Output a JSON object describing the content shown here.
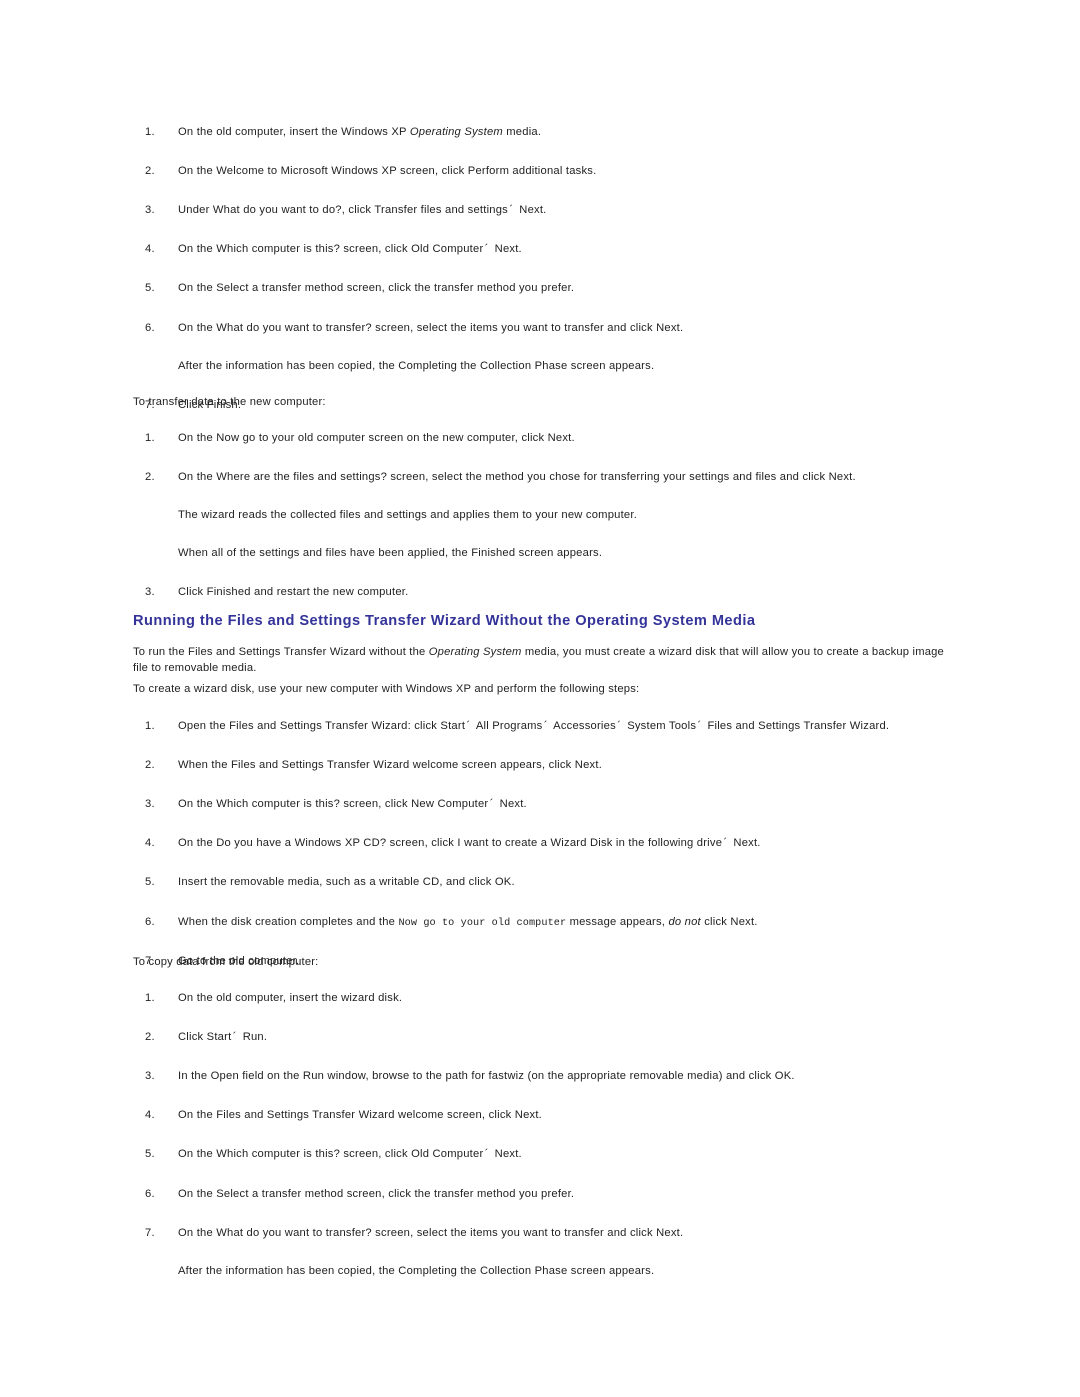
{
  "document": {
    "title": "Files and Settings Transfer Wizard",
    "heading_color": "#333399",
    "body_color": "#1f1f1f",
    "background": "#ffffff",
    "arrow_glyph": "´"
  },
  "section_one": {
    "steps_old_computer": [
      {
        "number": "1.",
        "parts": [
          {
            "text": "On the old computer, insert the Windows XP "
          },
          {
            "text": "Operating System",
            "style": "italic"
          },
          {
            "text": " media."
          }
        ]
      },
      {
        "number": "2.",
        "parts": [
          {
            "text": "On the Welcome to Microsoft Windows XP screen, click Perform additional tasks."
          }
        ]
      },
      {
        "number": "3.",
        "parts": [
          {
            "text": "Under What do you want to do?, click Transfer files and settings"
          },
          {
            "text": "´",
            "style": "arrow"
          },
          {
            "text": " Next."
          }
        ]
      },
      {
        "number": "4.",
        "parts": [
          {
            "text": "On the Which computer is this? screen, click Old Computer"
          },
          {
            "text": "´",
            "style": "arrow"
          },
          {
            "text": " Next."
          }
        ]
      },
      {
        "number": "5.",
        "parts": [
          {
            "text": "On the Select a transfer method screen, click the transfer method you prefer."
          }
        ]
      },
      {
        "number": "6.",
        "parts": [
          {
            "text": "On the What do you want to transfer? screen, select the items you want to transfer and click Next."
          }
        ],
        "note": "After the information has been copied, the Completing the Collection Phase screen appears."
      },
      {
        "number": "7.",
        "parts": [
          {
            "text": "Click Finish."
          }
        ]
      }
    ],
    "transfer_lead_in": "To transfer data to the new computer:",
    "steps_new_computer": [
      {
        "number": "1.",
        "parts": [
          {
            "text": "On the Now go to your old computer screen on the new computer, click Next."
          }
        ]
      },
      {
        "number": "2.",
        "parts": [
          {
            "text": "On the Where are the files and settings? screen, select the method you chose for transferring your settings and files and click Next."
          }
        ],
        "note": "The wizard reads the collected files and settings and applies them to your new computer.",
        "note2": "When all of the settings and files have been applied, the Finished screen appears."
      },
      {
        "number": "3.",
        "parts": [
          {
            "text": "Click Finished and restart the new computer."
          }
        ]
      }
    ]
  },
  "section_two": {
    "heading": "Running the Files and Settings Transfer Wizard Without the Operating System Media",
    "intro_parts": [
      {
        "text": "To run the Files and Settings Transfer Wizard without the "
      },
      {
        "text": "Operating System",
        "style": "italic"
      },
      {
        "text": " media, you must create a wizard disk that will allow you to create a backup image file to removable media."
      }
    ],
    "sub_lead_in": "To create a wizard disk, use your new computer with Windows XP and perform the following steps:",
    "steps_wizard_disk": [
      {
        "number": "1.",
        "parts": [
          {
            "text": "Open the Files and Settings Transfer Wizard: click Start"
          },
          {
            "text": "´",
            "style": "arrow"
          },
          {
            "text": " All Programs"
          },
          {
            "text": "´",
            "style": "arrow"
          },
          {
            "text": " Accessories"
          },
          {
            "text": "´",
            "style": "arrow"
          },
          {
            "text": " System Tools"
          },
          {
            "text": "´",
            "style": "arrow"
          },
          {
            "text": " Files and Settings Transfer Wizard."
          }
        ]
      },
      {
        "number": "2.",
        "parts": [
          {
            "text": "When the Files and Settings Transfer Wizard welcome screen appears, click Next."
          }
        ]
      },
      {
        "number": "3.",
        "parts": [
          {
            "text": "On the Which computer is this? screen, click New Computer"
          },
          {
            "text": "´",
            "style": "arrow"
          },
          {
            "text": " Next."
          }
        ]
      },
      {
        "number": "4.",
        "parts": [
          {
            "text": "On the Do you have a Windows XP CD? screen, click I want to create a Wizard Disk in the following drive"
          },
          {
            "text": "´",
            "style": "arrow"
          },
          {
            "text": " Next."
          }
        ]
      },
      {
        "number": "5.",
        "parts": [
          {
            "text": "Insert the removable media, such as a writable CD, and click OK."
          }
        ]
      },
      {
        "number": "6.",
        "parts": [
          {
            "text": "When the disk creation completes and the "
          },
          {
            "text": "Now go to your old computer",
            "style": "mono"
          },
          {
            "text": " message appears, "
          },
          {
            "text": "do not",
            "style": "italic"
          },
          {
            "text": " click Next."
          }
        ]
      },
      {
        "number": "7.",
        "parts": [
          {
            "text": "Go to the old computer."
          }
        ]
      }
    ],
    "copy_lead_in": "To copy data from the old computer:",
    "steps_copy_data": [
      {
        "number": "1.",
        "parts": [
          {
            "text": "On the old computer, insert the wizard disk."
          }
        ]
      },
      {
        "number": "2.",
        "parts": [
          {
            "text": "Click Start"
          },
          {
            "text": "´",
            "style": "arrow"
          },
          {
            "text": " Run."
          }
        ]
      },
      {
        "number": "3.",
        "parts": [
          {
            "text": "In the Open field on the Run window, browse to the path for fastwiz (on the appropriate removable media) and click OK."
          }
        ]
      },
      {
        "number": "4.",
        "parts": [
          {
            "text": "On the Files and Settings Transfer Wizard welcome screen, click Next."
          }
        ]
      },
      {
        "number": "5.",
        "parts": [
          {
            "text": "On the Which computer is this? screen, click Old Computer"
          },
          {
            "text": "´",
            "style": "arrow"
          },
          {
            "text": " Next."
          }
        ]
      },
      {
        "number": "6.",
        "parts": [
          {
            "text": "On the Select a transfer method screen, click the transfer method you prefer."
          }
        ]
      },
      {
        "number": "7.",
        "parts": [
          {
            "text": "On the What do you want to transfer? screen, select the items you want to transfer and click Next."
          }
        ],
        "note": "After the information has been copied, the Completing the Collection Phase screen appears."
      }
    ]
  }
}
